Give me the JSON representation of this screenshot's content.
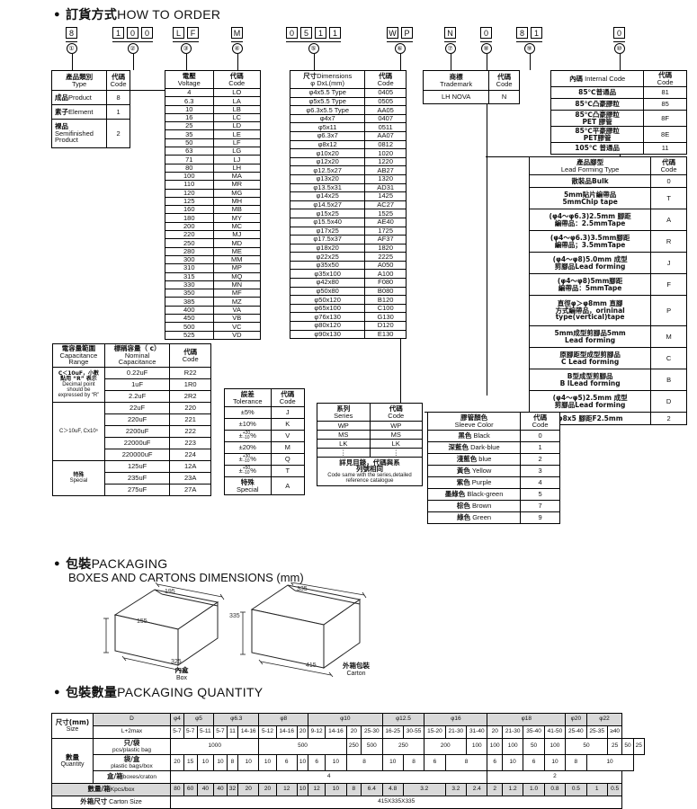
{
  "sections": {
    "how_to_order": {
      "bullet": "●",
      "cn": "訂貨方式",
      "en": "HOW TO ORDER"
    },
    "packaging": {
      "bullet": "●",
      "cn": "包裝",
      "en": "PACKAGING",
      "sub": "BOXES AND CARTONS DIMENSIONS (mm)"
    },
    "packaging_qty": {
      "bullet": "●",
      "cn": "包裝數量",
      "en": "PACKAGING QUANTITY"
    }
  },
  "order_code": {
    "groups": [
      {
        "chars": [
          "8"
        ],
        "num": "①"
      },
      {
        "chars": [
          "1",
          "0",
          "0"
        ],
        "num": "②"
      },
      {
        "chars": [
          "L",
          "F"
        ],
        "num": "③"
      },
      {
        "chars": [
          "M"
        ],
        "num": "④"
      },
      {
        "chars": [
          "0",
          "5",
          "1",
          "1"
        ],
        "num": "⑤"
      },
      {
        "chars": [
          "W",
          "P"
        ],
        "num": "⑥"
      },
      {
        "chars": [
          "N"
        ],
        "num": "⑦"
      },
      {
        "chars": [
          "0"
        ],
        "num": "⑧"
      },
      {
        "chars": [
          "8",
          "1"
        ],
        "num": "⑨"
      },
      {
        "chars": [
          "0"
        ],
        "num": "⑩"
      }
    ]
  },
  "type_table": {
    "header": {
      "cn": "產品類別",
      "en": "Type",
      "code_cn": "代碼",
      "code_en": "Code"
    },
    "rows": [
      {
        "cn": "成品",
        "en": "Product",
        "code": "8"
      },
      {
        "cn": "素子",
        "en": "Element",
        "code": "1"
      },
      {
        "cn": "裸品",
        "en": "Semifinished Product",
        "code": "2"
      }
    ]
  },
  "voltage_table": {
    "header": {
      "cn": "電壓",
      "en": "Voltage",
      "code_cn": "代碼",
      "code_en": "Code"
    },
    "rows": [
      {
        "v": "4",
        "code": "LO"
      },
      {
        "v": "6.3",
        "code": "LA"
      },
      {
        "v": "10",
        "code": "LB"
      },
      {
        "v": "16",
        "code": "LC"
      },
      {
        "v": "25",
        "code": "LD"
      },
      {
        "v": "35",
        "code": "LE"
      },
      {
        "v": "50",
        "code": "LF"
      },
      {
        "v": "63",
        "code": "LG"
      },
      {
        "v": "71",
        "code": "LJ"
      },
      {
        "v": "80",
        "code": "LH"
      },
      {
        "v": "100",
        "code": "MA"
      },
      {
        "v": "110",
        "code": "MR"
      },
      {
        "v": "120",
        "code": "MG"
      },
      {
        "v": "125",
        "code": "MH"
      },
      {
        "v": "160",
        "code": "MB"
      },
      {
        "v": "180",
        "code": "MY"
      },
      {
        "v": "200",
        "code": "MC"
      },
      {
        "v": "220",
        "code": "MJ"
      },
      {
        "v": "250",
        "code": "MD"
      },
      {
        "v": "280",
        "code": "ME"
      },
      {
        "v": "300",
        "code": "MM"
      },
      {
        "v": "310",
        "code": "MP"
      },
      {
        "v": "315",
        "code": "MQ"
      },
      {
        "v": "330",
        "code": "MN"
      },
      {
        "v": "350",
        "code": "MF"
      },
      {
        "v": "385",
        "code": "MZ"
      },
      {
        "v": "400",
        "code": "VA"
      },
      {
        "v": "450",
        "code": "VB"
      },
      {
        "v": "500",
        "code": "VC"
      },
      {
        "v": "525",
        "code": "VD"
      }
    ]
  },
  "dimension_table": {
    "header": {
      "cn": "尺寸",
      "en": "Dimensions",
      "sub": "φ DxL(mm)",
      "code_cn": "代碼",
      "code_en": "Code"
    },
    "rows": [
      {
        "d": "φ4x5.5 Type",
        "code": "0405"
      },
      {
        "d": "φ5x5.5 Type",
        "code": "0505"
      },
      {
        "d": "φ6.3x5.5 Type",
        "code": "AA05"
      },
      {
        "d": "φ4x7",
        "code": "0407"
      },
      {
        "d": "φ5x11",
        "code": "0511"
      },
      {
        "d": "φ6.3x7",
        "code": "AA07"
      },
      {
        "d": "φ8x12",
        "code": "0812"
      },
      {
        "d": "φ10x20",
        "code": "1020"
      },
      {
        "d": "φ12x20",
        "code": "1220"
      },
      {
        "d": "φ12.5x27",
        "code": "AB27"
      },
      {
        "d": "φ13x20",
        "code": "1320"
      },
      {
        "d": "φ13.5x31",
        "code": "AD31"
      },
      {
        "d": "φ14x25",
        "code": "1425"
      },
      {
        "d": "φ14.5x27",
        "code": "AC27"
      },
      {
        "d": "φ15x25",
        "code": "1525"
      },
      {
        "d": "φ15.5x40",
        "code": "AE40"
      },
      {
        "d": "φ17x25",
        "code": "1725"
      },
      {
        "d": "φ17.5x37",
        "code": "AF37"
      },
      {
        "d": "φ18x20",
        "code": "1820"
      },
      {
        "d": "φ22x25",
        "code": "2225"
      },
      {
        "d": "φ35x50",
        "code": "A050"
      },
      {
        "d": "φ35x100",
        "code": "A100"
      },
      {
        "d": "φ42x80",
        "code": "F080"
      },
      {
        "d": "φ50x80",
        "code": "B080"
      },
      {
        "d": "φ50x120",
        "code": "B120"
      },
      {
        "d": "φ65x100",
        "code": "C100"
      },
      {
        "d": "φ76x130",
        "code": "G130"
      },
      {
        "d": "φ80x120",
        "code": "D120"
      },
      {
        "d": "φ90x130",
        "code": "E130"
      }
    ]
  },
  "trademark_table": {
    "header": {
      "cn": "商標",
      "en": "Trademark",
      "code_cn": "代碼",
      "code_en": "Code"
    },
    "rows": [
      {
        "name": "LH NOVA",
        "code": "N"
      }
    ]
  },
  "internal_code_table": {
    "header": {
      "cn": "內碼",
      "en": "Internal Code",
      "code_cn": "代碼",
      "code_en": "Code"
    },
    "rows": [
      {
        "desc": "85℃普通品",
        "desc2": "",
        "code": "81"
      },
      {
        "desc": "85℃凸豪膠粒",
        "desc2": "",
        "code": "85"
      },
      {
        "desc": "85℃凸豪膠粒",
        "desc2": "PET 膠管",
        "code": "8F"
      },
      {
        "desc": "85℃平豪膠粒",
        "desc2": "PET膠管",
        "code": "8E"
      },
      {
        "desc": "105℃ 普通品",
        "desc2": "",
        "code": "11"
      }
    ]
  },
  "lead_forming_table": {
    "header": {
      "cn": "產品腳型",
      "en": "Lead Forming Type",
      "code_cn": "代碼",
      "code_en": "Code"
    },
    "rows": [
      {
        "l1": "散裝品Bulk",
        "l2": "",
        "l3": "",
        "code": "0"
      },
      {
        "l1": "5mm貼片編帶品",
        "l2": "5mmChip tape",
        "l3": "",
        "code": "T"
      },
      {
        "l1": "(φ4～φ6.3)2.5mm 腳距",
        "l2": "編帶品：2.5mmTape",
        "l3": "",
        "code": "A"
      },
      {
        "l1": "(φ4～φ6.3)3.5mm腳距",
        "l2": "編帶品；3.5mmTape",
        "l3": "",
        "code": "R"
      },
      {
        "l1": "(φ4～φ8)5.0mm 成型",
        "l2": "剪腳品Lead forming",
        "l3": "",
        "code": "J"
      },
      {
        "l1": "(φ4～φ8)5mm腳距",
        "l2": "編帶品：5mmTape",
        "l3": "",
        "code": "F"
      },
      {
        "l1": "直徑φ＞φ8mm 直腳",
        "l2": "方式編帶品，orininal",
        "l3": "type(vertical)tape",
        "code": "P"
      },
      {
        "l1": "5mm成型剪腳品5mm",
        "l2": "Lead forming",
        "l3": "",
        "code": "M"
      },
      {
        "l1": "原腳距型成型剪腳品",
        "l2": "C Lead forming",
        "l3": "",
        "code": "C"
      },
      {
        "l1": "B型成型剪腳品",
        "l2": "B lLead forming",
        "l3": "",
        "code": "B"
      },
      {
        "l1": "(φ4～φ5)2.5mm 成型",
        "l2": "剪腳品Lead forming",
        "l3": "",
        "code": "D"
      },
      {
        "l1": "φ8x5 腳距F2.5mm",
        "l2": "",
        "l3": "",
        "code": "2"
      }
    ]
  },
  "capacitance_table": {
    "header": {
      "range_cn": "電容量範圍",
      "range_en": "Capacitance Range",
      "nom_cn": "標稱容量（ c）",
      "nom_en": "Nominal Capacitance",
      "code_cn": "代碼",
      "code_en": "Code"
    },
    "groups": [
      {
        "range_cn": "C＜10uF，小數",
        "range_cn2": "點用 “R” 表示",
        "range_en": "Decimal point should be expressed by “R”",
        "rows": [
          {
            "cap": "0.22uF",
            "code": "R22"
          },
          {
            "cap": "1uF",
            "code": "1R0"
          },
          {
            "cap": "2.2uF",
            "code": "2R2"
          }
        ]
      },
      {
        "range_cn": "",
        "range_cn2": "",
        "range_en": "C＞10uF, Cx10ⁿ",
        "rows": [
          {
            "cap": "22uF",
            "code": "220"
          },
          {
            "cap": "220uF",
            "code": "221"
          },
          {
            "cap": "2200uF",
            "code": "222"
          },
          {
            "cap": "22000uF",
            "code": "223"
          },
          {
            "cap": "220000uF",
            "code": "224"
          }
        ]
      },
      {
        "range_cn": "特殊",
        "range_cn2": "",
        "range_en": "Special",
        "rows": [
          {
            "cap": "125uF",
            "code": "12A"
          },
          {
            "cap": "235uF",
            "code": "23A"
          },
          {
            "cap": "275uF",
            "code": "27A"
          }
        ]
      }
    ]
  },
  "tolerance_table": {
    "header": {
      "cn": "誤差",
      "en": "Tolerance",
      "code_cn": "代碼",
      "code_en": "Code"
    },
    "rows": [
      {
        "tol": "±5%",
        "num": "",
        "den": "",
        "code": "J"
      },
      {
        "tol": "±10%",
        "num": "",
        "den": "",
        "code": "K"
      },
      {
        "tol": "±%",
        "num": "+20",
        "den": "-10",
        "code": "V"
      },
      {
        "tol": "±20%",
        "num": "",
        "den": "",
        "code": "M"
      },
      {
        "tol": "±%",
        "num": "+30",
        "den": "-10",
        "code": "Q"
      },
      {
        "tol": "±%",
        "num": "+50",
        "den": "-10",
        "code": "T"
      },
      {
        "tol": "特殊",
        "num": "",
        "den": "",
        "en": "Special",
        "code": "A"
      }
    ]
  },
  "series_table": {
    "header": {
      "cn": "系列",
      "en": "Series",
      "code_cn": "代碼",
      "code_en": "Code"
    },
    "rows": [
      {
        "series": "WP",
        "code": "WP"
      },
      {
        "series": "MS",
        "code": "MS"
      },
      {
        "series": "LK",
        "code": "LK"
      },
      {
        "series": "⋮",
        "code": "⋮"
      }
    ],
    "footer_cn": "詳見目錄，代碼與系",
    "footer_cn2": "列號相同",
    "footer_en": "Code same with the series,detailed reference catalogue"
  },
  "sleeve_color_table": {
    "header": {
      "cn": "膠管顏色",
      "en": "Sleeve Color",
      "code_cn": "代碼",
      "code_en": "Code"
    },
    "rows": [
      {
        "cn": "黑色",
        "en": "Black",
        "code": "0"
      },
      {
        "cn": "深藍色",
        "en": "Dark-blue",
        "code": "1"
      },
      {
        "cn": "淺藍色",
        "en": "blue",
        "code": "2"
      },
      {
        "cn": "黃色",
        "en": "Yellow",
        "code": "3"
      },
      {
        "cn": "紫色",
        "en": "Purple",
        "code": "4"
      },
      {
        "cn": "墨綠色",
        "en": "Black-green",
        "code": "5"
      },
      {
        "cn": "棕色",
        "en": "Brown",
        "code": "7"
      },
      {
        "cn": "綠色",
        "en": "Green",
        "code": "9"
      }
    ]
  },
  "box_drawing": {
    "inner": {
      "w": "195",
      "h": "155",
      "d": "325",
      "cn": "內盒",
      "en": "Box"
    },
    "carton": {
      "w": "335",
      "h": "335",
      "d": "415",
      "cn": "外箱包裝",
      "en": "Carton"
    }
  },
  "quantity_table": {
    "row_labels": {
      "size_cn": "尺寸(mm)",
      "size_en": "Size",
      "d": "D",
      "l": "L+2max",
      "qty_cn": "數量",
      "qty_en": "Quantity",
      "pcs_cn": "只/袋",
      "pcs_en": "pcs/plastic bag",
      "bags_cn": "袋/盒",
      "bags_en": "plastic bags/box",
      "boxes_cn": "盒/箱",
      "boxes_en": "boxes/craton",
      "kpcs_cn": "數量/箱",
      "kpcs_en": "Kpcs/box",
      "carton_cn": "外箱尺寸",
      "carton_en": "Carton  Size"
    },
    "diameter_groups": [
      {
        "label": "φ4",
        "span": 1
      },
      {
        "label": "φ5",
        "span": 2
      },
      {
        "label": "φ6.3",
        "span": 3
      },
      {
        "label": "φ8",
        "span": 3
      },
      {
        "label": "φ10",
        "span": 4
      },
      {
        "label": "φ12.5",
        "span": 2
      },
      {
        "label": "φ16",
        "span": 3
      },
      {
        "label": "φ18",
        "span": 4
      },
      {
        "label": "φ20",
        "span": 1
      },
      {
        "label": "φ22",
        "span": 2
      }
    ],
    "lengths": [
      "5-7",
      "5-7",
      "5-11",
      "5-7",
      "11",
      "14-16",
      "5-12",
      "14-16",
      "20",
      "9-12",
      "14-16",
      "20",
      "25-30",
      "16-25",
      "30-55",
      "15-20",
      "21-30",
      "31-40",
      "20",
      "21-30",
      "35-40",
      "41-50",
      "25-40",
      "25-35",
      "≥40"
    ],
    "pcs_per_bag": [
      {
        "v": "1000",
        "span": 6
      },
      {
        "v": "500",
        "span": 5
      },
      {
        "v": "250",
        "span": 1
      },
      {
        "v": "500",
        "span": 1
      },
      {
        "v": "250",
        "span": 2
      },
      {
        "v": "200",
        "span": 2
      },
      {
        "v": "100",
        "span": 1
      },
      {
        "v": "100",
        "span": 1
      },
      {
        "v": "100",
        "span": 1
      },
      {
        "v": "50",
        "span": 1
      },
      {
        "v": "100",
        "span": 1
      },
      {
        "v": "50",
        "span": 2
      },
      {
        "v": "25",
        "span": 1
      },
      {
        "v": "50",
        "span": 1
      },
      {
        "v": "25",
        "span": 1
      }
    ],
    "bags_per_box": [
      {
        "v": "20",
        "span": 1
      },
      {
        "v": "15",
        "span": 1
      },
      {
        "v": "10",
        "span": 1
      },
      {
        "v": "10",
        "span": 1
      },
      {
        "v": "8",
        "span": 1
      },
      {
        "v": "10",
        "span": 1
      },
      {
        "v": "10",
        "span": 1
      },
      {
        "v": "6",
        "span": 1
      },
      {
        "v": "10",
        "span": 1
      },
      {
        "v": "6",
        "span": 1
      },
      {
        "v": "10",
        "span": 1
      },
      {
        "v": "8",
        "span": 2
      },
      {
        "v": "10",
        "span": 1
      },
      {
        "v": "8",
        "span": 1
      },
      {
        "v": "6",
        "span": 1
      },
      {
        "v": "8",
        "span": 2
      },
      {
        "v": "6",
        "span": 1
      },
      {
        "v": "10",
        "span": 1
      },
      {
        "v": "6",
        "span": 1
      },
      {
        "v": "10",
        "span": 1
      },
      {
        "v": "8",
        "span": 1
      },
      {
        "v": "10",
        "span": 3
      }
    ],
    "boxes_per_carton": [
      {
        "v": "4",
        "span": 18
      },
      {
        "v": "2",
        "span": 7
      }
    ],
    "kpcs_per_box": [
      "80",
      "60",
      "40",
      "40",
      "32",
      "20",
      "20",
      "12",
      "10",
      "12",
      "10",
      "8",
      "6.4",
      "4.8",
      "3.2",
      "3.2",
      "2.4",
      "2",
      "1.2",
      "1.0",
      "0.8",
      "0.5",
      "1",
      "0.5"
    ],
    "carton_size": "415X335X335"
  }
}
